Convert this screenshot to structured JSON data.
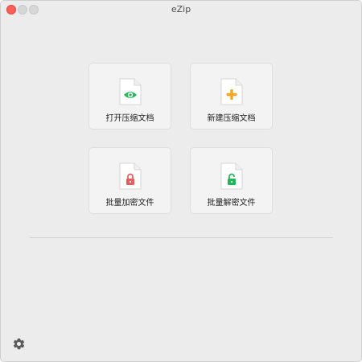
{
  "window": {
    "title": "eZip"
  },
  "actions": {
    "open_label": "打开压缩文档",
    "new_label": "新建压缩文档",
    "encrypt_label": "批量加密文件",
    "decrypt_label": "批量解密文件"
  },
  "icons": {
    "open": "eye-icon",
    "new": "plus-icon",
    "encrypt": "lock-closed-icon",
    "decrypt": "lock-open-icon",
    "settings": "gear-icon"
  },
  "colors": {
    "close": "#fe5f57",
    "eye": "#1db954",
    "plus": "#f5a623",
    "lock_red": "#e85c5c",
    "lock_green": "#1db954"
  }
}
